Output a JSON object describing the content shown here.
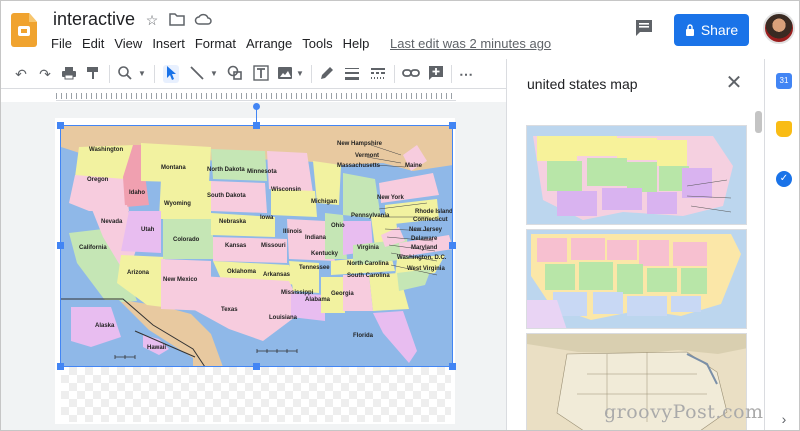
{
  "window": {
    "title": "interactive"
  },
  "menu": [
    "File",
    "Edit",
    "View",
    "Insert",
    "Format",
    "Arrange",
    "Tools",
    "Help"
  ],
  "last_edit": "Last edit was 2 minutes ago",
  "share_label": "Share",
  "toolbar_icons": [
    "undo-icon",
    "redo-icon",
    "print-icon",
    "paint-format-icon",
    "zoom-icon",
    "select-icon",
    "line-icon",
    "shape-icon",
    "textbox-icon",
    "image-icon",
    "pen-icon",
    "line-weight-icon",
    "line-dash-icon",
    "link-icon",
    "comment-add-icon",
    "more-icon"
  ],
  "search_panel": {
    "query": "united states map",
    "results_count": 3
  },
  "map_labels": {
    "states": [
      "Washington",
      "Oregon",
      "California",
      "Idaho",
      "Nevada",
      "Montana",
      "Wyoming",
      "Utah",
      "Arizona",
      "Colorado",
      "New Mexico",
      "North Dakota",
      "South Dakota",
      "Nebraska",
      "Kansas",
      "Oklahoma",
      "Texas",
      "Minnesota",
      "Iowa",
      "Missouri",
      "Arkansas",
      "Louisiana",
      "Wisconsin",
      "Illinois",
      "Mississippi",
      "Michigan",
      "Indiana",
      "Tennessee",
      "Alabama",
      "Ohio",
      "Kentucky",
      "Georgia",
      "Florida",
      "Pennsylvania",
      "New York",
      "Virginia",
      "North Carolina",
      "South Carolina",
      "West Virginia",
      "Maine",
      "New Hampshire",
      "Vermont",
      "Massachusetts",
      "Rhode Island",
      "Connecticut",
      "New Jersey",
      "Delaware",
      "Maryland",
      "Washington, D.C.",
      "Alaska",
      "Hawaii"
    ]
  },
  "watermark": "groovyPost.com",
  "colors": {
    "share": "#1a73e8",
    "selection": "#4285f4",
    "ocean": "#8fb8e8"
  }
}
